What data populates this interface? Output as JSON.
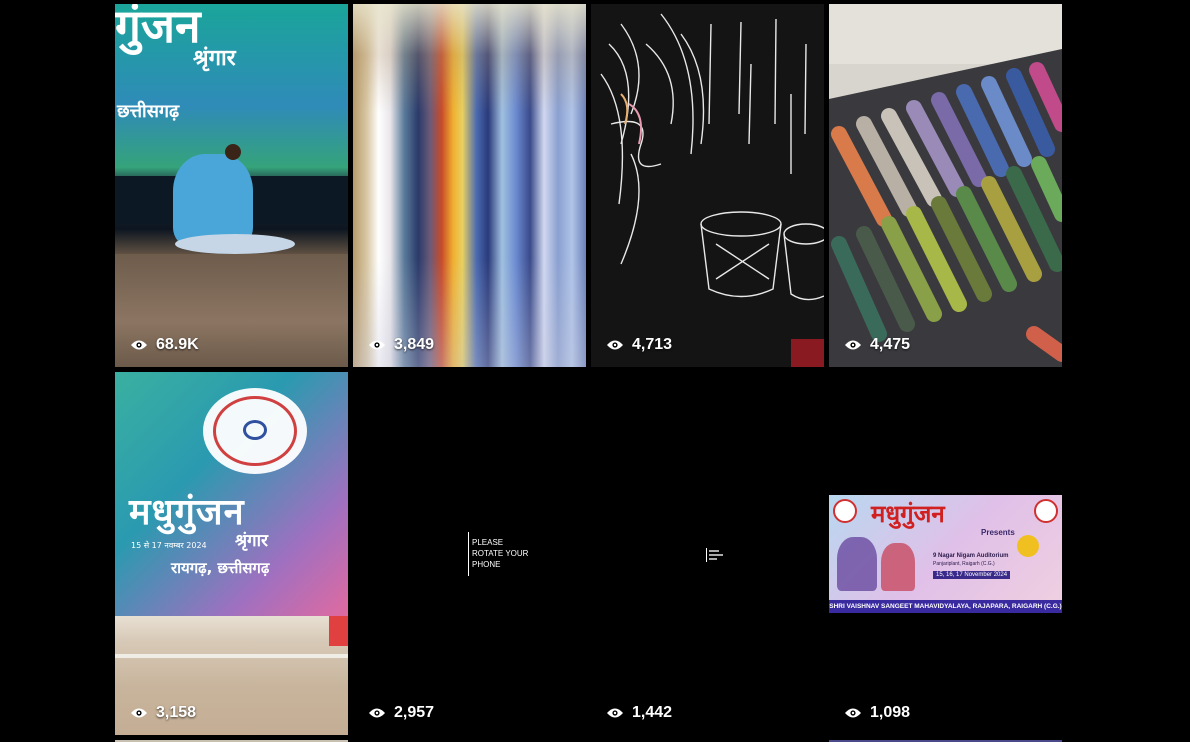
{
  "grid": {
    "tiles": [
      {
        "views": "68.9K",
        "thumb_text": [
          "गुंजन",
          "श्रृंगार",
          "छत्तीसगढ़"
        ]
      },
      {
        "views": "3,849"
      },
      {
        "views": "4,713"
      },
      {
        "views": "4,475"
      },
      {
        "views": "3,158",
        "thumb_text": [
          "मधुगुंजन",
          "श्रृंगार",
          "15 से 17 नवम्बर 2024",
          "रायगढ़, छत्तीसगढ़"
        ]
      },
      {
        "views": "2,957",
        "thumb_text": [
          "PLEASE",
          "ROTATE YOUR",
          "PHONE"
        ]
      },
      {
        "views": "1,442"
      },
      {
        "views": "1,098",
        "thumb_text": [
          "मधुगुंजन",
          "Presents",
          "9 Nagar Nigam Auditorium",
          "Panjariplant, Raigarh (C.G.)",
          "15, 16, 17 November 2024",
          "SHRI VAISHNAV SANGEET MAHAVIDYALAYA, RAJAPARA, RAIGARH (C.G.)"
        ]
      }
    ]
  },
  "icons": {
    "views": "eye-icon"
  }
}
